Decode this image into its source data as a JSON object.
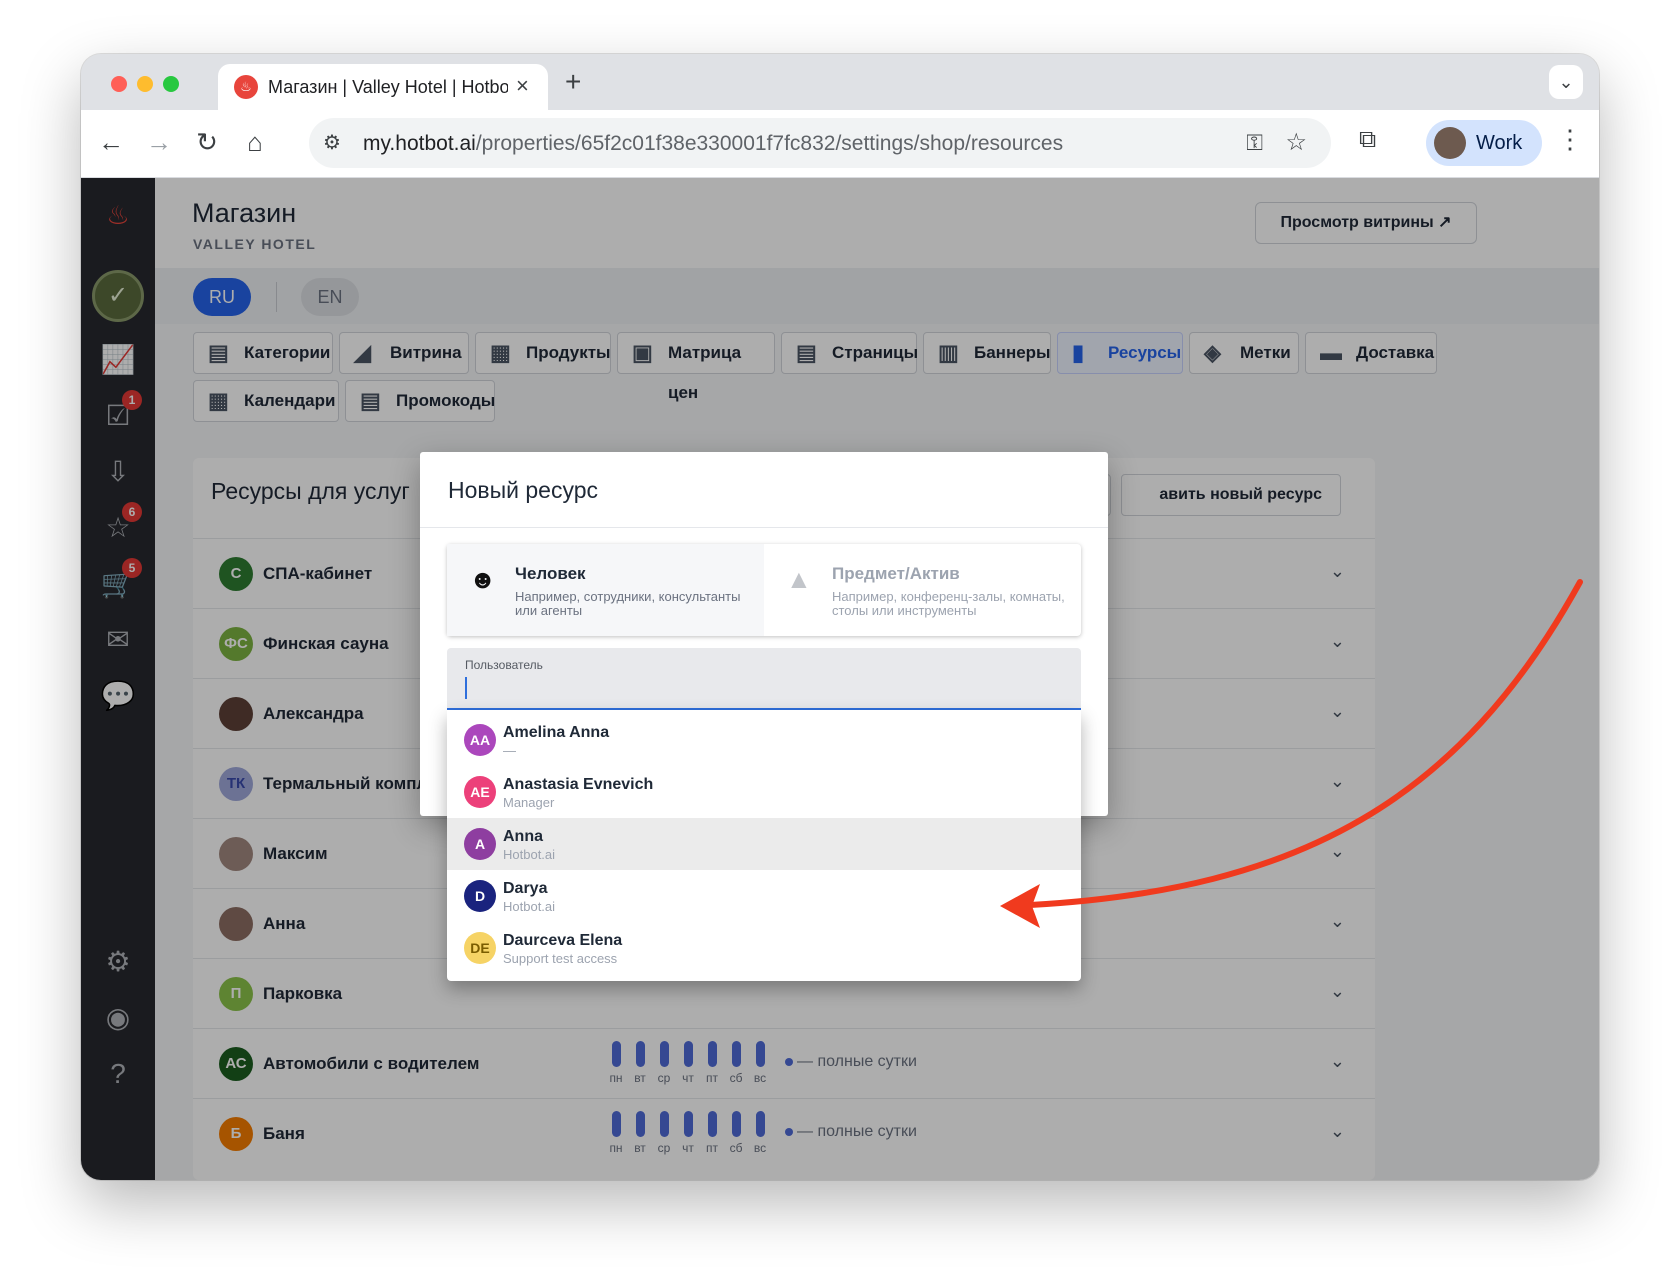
{
  "browser": {
    "tab_title": "Магазин | Valley Hotel | Hotbot",
    "url_host": "my.hotbot.ai",
    "url_path": "/properties/65f2c01f38e330001f7fc832/settings/shop/resources",
    "profile_label": "Work"
  },
  "sidebar": {
    "badges": {
      "tasks": "1",
      "reviews": "6",
      "orders": "5"
    }
  },
  "header": {
    "title": "Магазин",
    "subtitle": "VALLEY HOTEL",
    "storefront_button": "Просмотр витрины ↗"
  },
  "languages": {
    "ru": "RU",
    "en": "EN"
  },
  "shop_tabs": [
    {
      "label": "Категории",
      "icon": "storefront-icon"
    },
    {
      "label": "Витрина",
      "icon": "brush-icon"
    },
    {
      "label": "Продукты",
      "icon": "widgets-icon"
    },
    {
      "label": "Матрица цен",
      "icon": "calculator-icon"
    },
    {
      "label": "Страницы",
      "icon": "document-icon"
    },
    {
      "label": "Баннеры",
      "icon": "pages-icon"
    },
    {
      "label": "Ресурсы",
      "icon": "resources-icon",
      "active": true
    },
    {
      "label": "Метки",
      "icon": "tag-icon"
    },
    {
      "label": "Доставка",
      "icon": "truck-icon"
    },
    {
      "label": "Календари",
      "icon": "calendar-icon"
    },
    {
      "label": "Промокоды",
      "icon": "promo-icon"
    }
  ],
  "resources": {
    "title": "Ресурсы для услуг",
    "add_button": "авить новый ресурс",
    "day_labels": [
      "пн",
      "вт",
      "ср",
      "чт",
      "пт",
      "сб",
      "вс"
    ],
    "full_day_label": "— полные сутки",
    "items": [
      {
        "initials": "С",
        "name": "СПА-кабинет",
        "color": "#2e7d32"
      },
      {
        "initials": "ФС",
        "name": "Финская сауна",
        "color": "#7cb342"
      },
      {
        "initials": "",
        "name": "Александра",
        "color": "#5d4037"
      },
      {
        "initials": "ТК",
        "name": "Термальный комплекс",
        "color": "#9fa8da"
      },
      {
        "initials": "",
        "name": "Максим",
        "color": "#a1887f"
      },
      {
        "initials": "",
        "name": "Анна",
        "color": "#8d6e63"
      },
      {
        "initials": "П",
        "name": "Парковка",
        "color": "#8bc34a"
      },
      {
        "initials": "АС",
        "name": "Автомобили с водителем",
        "color": "#1b5e20"
      },
      {
        "initials": "Б",
        "name": "Баня",
        "color": "#f57c00"
      }
    ]
  },
  "modal": {
    "title": "Новый ресурс",
    "option_person": {
      "name": "Человек",
      "desc": "Например, сотрудники, консультанты или агенты"
    },
    "option_asset": {
      "name": "Предмет/Актив",
      "desc": "Например, конференц-залы, комнаты, столы или инструменты"
    },
    "user_field_label": "Пользователь",
    "user_field_value": ""
  },
  "user_options": [
    {
      "initials": "AA",
      "name": "Amelina Anna",
      "sub": "—",
      "color": "#ab47bc"
    },
    {
      "initials": "AE",
      "name": "Anastasia Evnevich",
      "sub": "Manager",
      "color": "#ec407a"
    },
    {
      "initials": "A",
      "name": "Anna",
      "sub": "Hotbot.ai",
      "color": "#8e3ea0",
      "highlighted": true
    },
    {
      "initials": "D",
      "name": "Darya",
      "sub": "Hotbot.ai",
      "color": "#1a237e"
    },
    {
      "initials": "DE",
      "name": "Daurceva Elena",
      "sub": "Support test access",
      "color": "#f6d365",
      "text_color": "#7a5c00"
    }
  ],
  "annotation": {
    "arrow_color": "#f03a1e"
  }
}
